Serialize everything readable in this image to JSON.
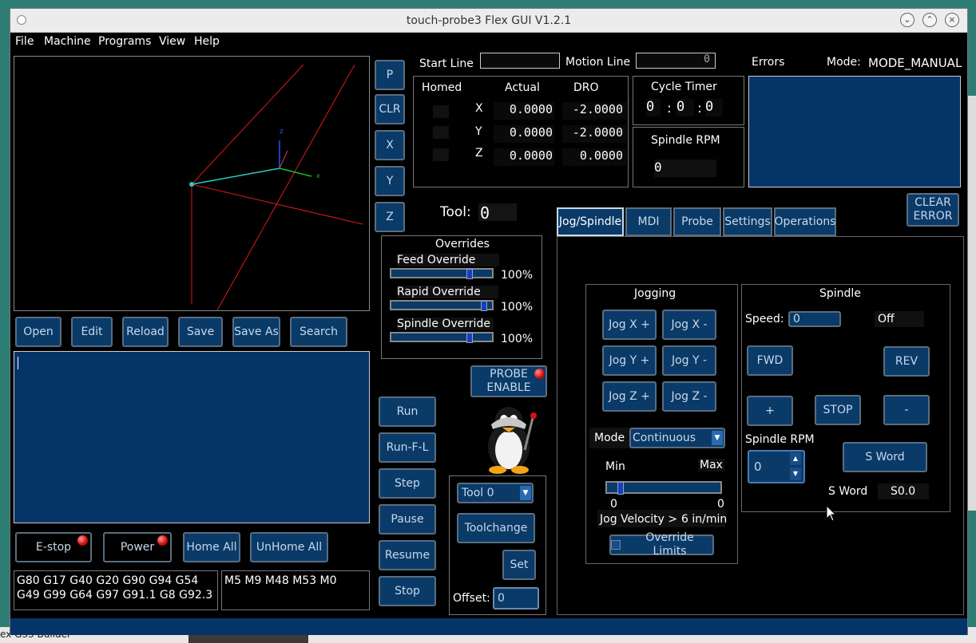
{
  "window": {
    "title": "touch-probe3 Flex GUI V1.2.1"
  },
  "desktop": {
    "taskbar_label": "ex G33 Builder"
  },
  "menu": [
    "File",
    "Machine",
    "Programs",
    "View",
    "Help"
  ],
  "file_buttons": [
    "Open",
    "Edit",
    "Reload",
    "Save",
    "Save As",
    "Search"
  ],
  "plot_buttons": [
    "P",
    "CLR",
    "X",
    "Y",
    "Z"
  ],
  "lines": {
    "start_label": "Start Line",
    "start_value": "",
    "motion_label": "Motion Line",
    "motion_value": "0"
  },
  "dro": {
    "homed_header": "Homed",
    "actual_header": "Actual",
    "dro_header": "DRO",
    "axes": [
      {
        "axis": "X",
        "actual": "0.0000",
        "dro": "-2.0000"
      },
      {
        "axis": "Y",
        "actual": "0.0000",
        "dro": "-2.0000"
      },
      {
        "axis": "Z",
        "actual": "0.0000",
        "dro": "0.0000"
      }
    ]
  },
  "cycle_timer": {
    "label": "Cycle Timer",
    "h": "0",
    "m": "0",
    "s": "0",
    "sep": ":"
  },
  "spindle_rpm_panel": {
    "label": "Spindle RPM",
    "value": "0"
  },
  "errors": {
    "label": "Errors",
    "clear_label": "CLEAR ERROR"
  },
  "mode": {
    "label": "Mode:",
    "value": "MODE_MANUAL"
  },
  "tool": {
    "label": "Tool:",
    "value": "0"
  },
  "overrides": {
    "title": "Overrides",
    "items": [
      {
        "label": "Feed Override",
        "value": "100%",
        "level": 0.8
      },
      {
        "label": "Rapid Override",
        "value": "100%",
        "level": 0.95
      },
      {
        "label": "Spindle Override",
        "value": "100%",
        "level": 0.8
      }
    ]
  },
  "probe": {
    "enable_label": "PROBE ENABLE"
  },
  "control_buttons": [
    "E-stop",
    "Power",
    "Home All",
    "UnHome All"
  ],
  "run_buttons": [
    "Run",
    "Run-F-L",
    "Step",
    "Pause",
    "Resume",
    "Stop"
  ],
  "toolchange": {
    "select": "Tool 0",
    "change_label": "Toolchange",
    "set_label": "Set",
    "offset_label": "Offset:",
    "offset_value": "0"
  },
  "gcodes": {
    "g": "G80 G17 G40 G20 G90 G94 G54 G49 G99 G64 G97 G91.1 G8 G92.3",
    "m": "M5 M9 M48 M53 M0"
  },
  "tabs": [
    "Jog/Spindle",
    "MDI",
    "Probe",
    "Settings",
    "Operations"
  ],
  "jogging": {
    "title": "Jogging",
    "buttons": [
      "Jog X +",
      "Jog X -",
      "Jog Y +",
      "Jog Y -",
      "Jog Z +",
      "Jog Z -"
    ],
    "mode_label": "Mode",
    "mode_value": "Continuous",
    "min_label": "Min",
    "max_label": "Max",
    "min_value": "0",
    "max_value": "0",
    "velocity_label": "Jog Velocity >",
    "velocity_value": "6 in/min",
    "override_label": "Override Limits"
  },
  "spindle": {
    "title": "Spindle",
    "speed_label": "Speed:",
    "speed_value": "0",
    "state": "Off",
    "fwd": "FWD",
    "rev": "REV",
    "plus": "+",
    "stop": "STOP",
    "minus": "-",
    "rpm_label": "Spindle RPM",
    "rpm_value": "0",
    "sword_button": "S Word",
    "sword_label": "S Word",
    "sword_value": "S0.0"
  },
  "colors": {
    "button_bg": "#0a3a68",
    "panel_bg": "#000000",
    "led": "#d81010"
  }
}
